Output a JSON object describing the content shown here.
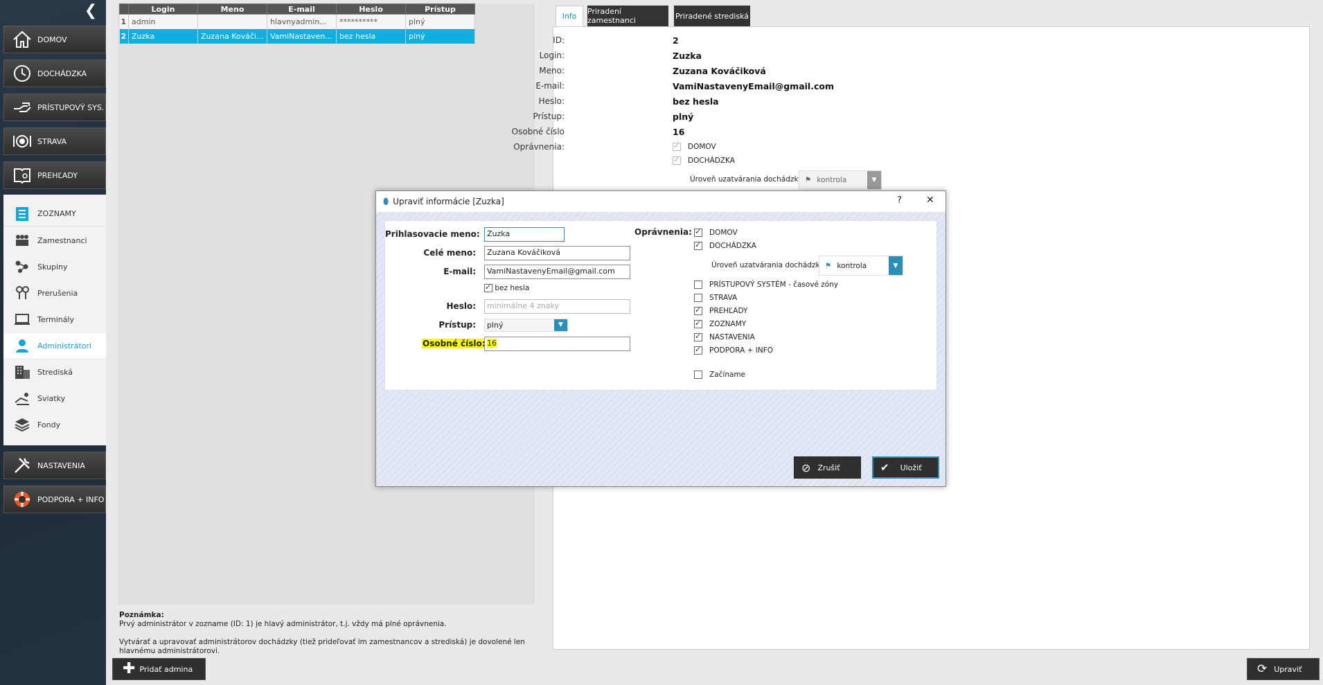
{
  "sidebar": {
    "main_items": [
      {
        "label": "DOMOV",
        "icon": "home-icon"
      },
      {
        "label": "DOCHÁDZKA",
        "icon": "clock-icon"
      },
      {
        "label": "PRÍSTUPOVÝ SYS.",
        "icon": "hand-key-icon"
      },
      {
        "label": "STRAVA",
        "icon": "plate-icon"
      },
      {
        "label": "PREHĽADY",
        "icon": "book-search-icon"
      }
    ],
    "sub_items": [
      {
        "label": "ZOZNAMY",
        "icon": "list-icon"
      },
      {
        "label": "Zamestnanci",
        "icon": "people-icon"
      },
      {
        "label": "Skupiny",
        "icon": "groups-icon"
      },
      {
        "label": "Prerušenia",
        "icon": "pins-icon"
      },
      {
        "label": "Terminály",
        "icon": "terminal-icon"
      },
      {
        "label": "Administrátori",
        "icon": "admin-icon"
      },
      {
        "label": "Strediská",
        "icon": "building-icon"
      },
      {
        "label": "Sviatky",
        "icon": "holiday-icon"
      },
      {
        "label": "Fondy",
        "icon": "layers-icon"
      }
    ],
    "bottom_items": [
      {
        "label": "NASTAVENIA",
        "icon": "tools-icon"
      },
      {
        "label": "PODPORA + INFO",
        "icon": "lifebuoy-icon"
      }
    ]
  },
  "grid": {
    "columns": [
      "Login",
      "Meno",
      "E-mail",
      "Heslo",
      "Prístup"
    ],
    "rows": [
      {
        "n": "1",
        "cells": [
          "admin",
          "",
          "hlavnyadmin...",
          "**********",
          "plný"
        ]
      },
      {
        "n": "2",
        "cells": [
          "Zuzka",
          "Zuzana Kováči...",
          "VamiNastaven...",
          "bez hesla",
          "plný"
        ]
      }
    ]
  },
  "note": {
    "title": "Poznámka:",
    "line1": "Prvý administrátor v zozname (ID: 1) je hlavý administrátor, t.j. vždy má plné oprávnenia.",
    "line2": "Vytvárať a upravovať administrátorov dochádzky (tiež prideľovať im zamestnancov a strediská) je dovolené len hlavnému administrátorovi."
  },
  "add_button": "Pridať admina",
  "tabs": [
    "Info",
    "Priradení zamestnanci",
    "Priradené strediská"
  ],
  "info": {
    "labels": [
      "ID:",
      "Login:",
      "Meno:",
      "E-mail:",
      "Heslo:",
      "Prístup:",
      "Osobné číslo",
      "Oprávnenia:"
    ],
    "values": [
      "2",
      "Zuzka",
      "Zuzana Kováčiková",
      "VamiNastavenyEmail@gmail.com",
      "bez hesla",
      "plný",
      "16"
    ],
    "perms": [
      "DOMOV",
      "DOCHÁDZKA"
    ],
    "closing_label": "Úroveň uzatvárania dochádzky",
    "closing_value": "kontrola"
  },
  "update_button": "Upraviť",
  "dialog": {
    "title": "Upraviť informácie [Zuzka]",
    "help": "?",
    "close": "✕",
    "labels": {
      "login": "Prihlasovacie meno:",
      "fullname": "Celé meno:",
      "email": "E-mail:",
      "password": "Heslo:",
      "access": "Prístup:",
      "personal": "Osobné číslo:",
      "perms": "Oprávnenia:"
    },
    "values": {
      "login": "Zuzka",
      "fullname": "Zuzana Kováčiková",
      "email": "VamiNastavenyEmail@gmail.com",
      "password_placeholder": "minimálne 4 znaky",
      "no_password": "bez hesla",
      "access": "plný",
      "personal": "16"
    },
    "perm_items": [
      {
        "label": "DOMOV",
        "checked": true
      },
      {
        "label": "DOCHÁDZKA",
        "checked": true
      },
      {
        "label": "PRÍSTUPOVÝ SYSTÉM - časové zóny",
        "checked": false
      },
      {
        "label": "STRAVA",
        "checked": false
      },
      {
        "label": "PREHĽADY",
        "checked": true
      },
      {
        "label": "ZOZNAMY",
        "checked": true
      },
      {
        "label": "NASTAVENIA",
        "checked": true
      },
      {
        "label": "PODPORA + INFO",
        "checked": true
      },
      {
        "label": "Začíname",
        "checked": false
      }
    ],
    "closing_label": "Úroveň uzatvárania dochádzky",
    "closing_value": "kontrola",
    "cancel": "Zrušiť",
    "save": "Uložiť"
  },
  "colors": {
    "accent": "#1aa3d9",
    "selected_row": "#0fb0e0",
    "highlight": "#ffff00",
    "dropdown": "#2a8fb8"
  }
}
